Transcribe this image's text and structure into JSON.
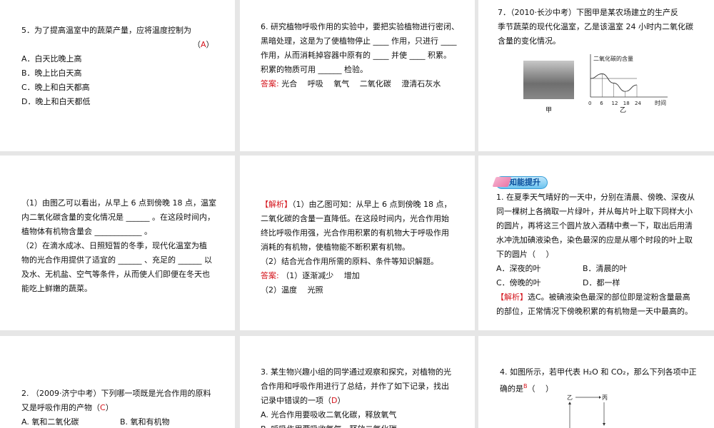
{
  "slides": {
    "s1": {
      "question": "5．为了提高温室中的蔬菜产量，应将温度控制为",
      "answer_open": "（",
      "answer": "A",
      "answer_close": "）",
      "options": [
        "A．白天比晚上高",
        "B．晚上比白天高",
        "C．晚上和白天都高",
        "D．晚上和白天都低"
      ]
    },
    "s2": {
      "lines": [
        "6. 研究植物呼吸作用的实验中，要把实验植物进行密闭、",
        "黑暗处理，这是为了使植物停止 ____ 作用，只进行 ____",
        "作用，从而消耗掉容器中原有的 ____ 并使 ____ 积累。",
        "积累的物质可用 ______ 检验。"
      ],
      "answer_label": "答案:",
      "answer_text": "光合　 呼吸　 氧气　 二氧化碳　 澄清石灰水"
    },
    "s3": {
      "lines": [
        "7．（2010·长沙中考）下图甲是某农场建立的生产反",
        "季节蔬菜的现代化温室，乙是该温室 24 小时内二氧化碳",
        "含量的变化情况。"
      ],
      "photo_caption": "甲",
      "chart_caption": "乙",
      "chart_data": {
        "type": "line",
        "title": "二氧化碳的含量",
        "xlabel": "时间",
        "x_ticks": [
          "0",
          "6",
          "12",
          "18",
          "24"
        ],
        "x": [
          0,
          6,
          12,
          18,
          24
        ],
        "values": [
          1.0,
          1.25,
          0.75,
          0.3,
          0.65
        ]
      }
    },
    "s4": {
      "lines": [
        "（1）由图乙可以看出，从早上 6 点到傍晚 18 点，温室",
        "内二氧化碳含量的变化情况是 ______ 。在这段时间内，",
        "植物体有机物含量会 ____________ 。",
        "（2）在滴水成冰、日照短暂的冬季，现代化温室为植",
        "物的光合作用提供了适宜的 ______ 、充足的 ______ 以",
        "及水、无机盐、空气等条件，从而使人们即便在冬天也",
        "能吃上鲜嫩的蔬菜。"
      ]
    },
    "s5": {
      "analysis_label": "【解析】",
      "lines": [
        "（1）由乙图可知：从早上 6 点到傍晚 18 点，",
        "二氧化碳的含量一直降低。在这段时间内，光合作用始",
        "终比呼吸作用强，光合作用积累的有机物大于呼吸作用",
        "消耗的有机物，使植物能不断积累有机物。",
        "（2）结合光合作用所需的原料、条件等知识解题。"
      ],
      "answer_label": "答案:",
      "answer_1": "（1）逐渐减少　 增加",
      "answer_2": "（2）温度　 光照"
    },
    "s6": {
      "badge": "知能提升",
      "lines": [
        "1. 在夏季天气晴好的一天中，分别在清晨、傍晚、深夜从",
        "同一棵树上各摘取一片绿叶，并从每片叶上取下同样大小",
        "的圆片，再将这三个圆片放入酒精中煮一下，取出后用清",
        "水冲洗加碘液染色，染色最深的应是从哪个时段的叶上取",
        "下的圆片（　 ）"
      ],
      "options": [
        "A．深夜的叶",
        "B．清晨的叶",
        "C．傍晚的叶",
        "D．都一样"
      ],
      "analysis_label": "【解析】",
      "analysis_1": "选C。被碘液染色最深的部位即是淀粉含量最高",
      "analysis_2": "的部位，正常情况下傍晚积累的有机物是一天中最高的。"
    },
    "s7": {
      "line1": "2. （2009·济宁中考）下列哪一项既是光合作用的原料",
      "line2_pre": "又是呼吸作用的产物（",
      "answer": "C",
      "line2_post": "）",
      "options": [
        "A. 氧和二氧化碳",
        "B. 氧和有机物"
      ]
    },
    "s8": {
      "lines": [
        "3. 某生物兴趣小组的同学通过观察和探究，对植物的光",
        "合作用和呼吸作用进行了总结，并作了如下记录，找出"
      ],
      "line3_pre": "记录中错误的一项（",
      "answer": "D",
      "line3_post": "）",
      "options": [
        "A. 光合作用要吸收二氧化碳，释放氧气",
        "B. 呼吸作用要吸收氧气，释放二氧化碳"
      ]
    },
    "s9": {
      "line1": "4. 如图所示，若甲代表 H₂O 和 CO₂，那么下列各项中正",
      "line2_pre": "确的是",
      "answer": "B",
      "line2_post": "（　 ）",
      "diagram_labels": [
        "乙",
        "丙"
      ]
    }
  }
}
